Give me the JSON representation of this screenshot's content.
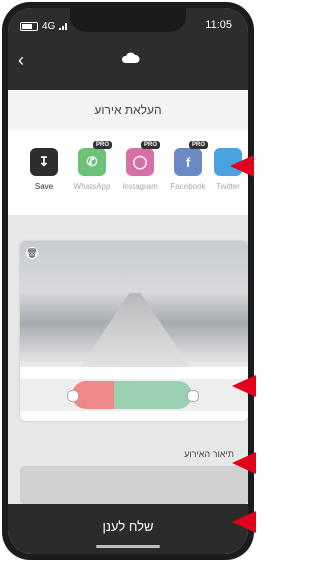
{
  "status_bar": {
    "network": "4G",
    "time": "11:05"
  },
  "header": {
    "back_icon": "chevron-left-icon",
    "logo_icon": "cloud-icon"
  },
  "upload_event": {
    "title": "העלאת אירוע"
  },
  "share": {
    "items": [
      {
        "label": "Save",
        "pro": "",
        "color": "#2d2d2d"
      },
      {
        "label": "WhatsApp",
        "pro": "PRO",
        "color": "#6cc277"
      },
      {
        "label": "Instagram",
        "pro": "PRO",
        "color": "#d870a8"
      },
      {
        "label": "Facebook",
        "pro": "PRO",
        "color": "#6b89c4"
      },
      {
        "label": "Twitter",
        "pro": "",
        "color": "#4aa3e0"
      }
    ]
  },
  "video": {
    "delete_icon": "trash-icon"
  },
  "event_description": {
    "label": "תיאור האירוע"
  },
  "send_button": {
    "label": "שלח לענן"
  },
  "accent_color": "#e3001b"
}
